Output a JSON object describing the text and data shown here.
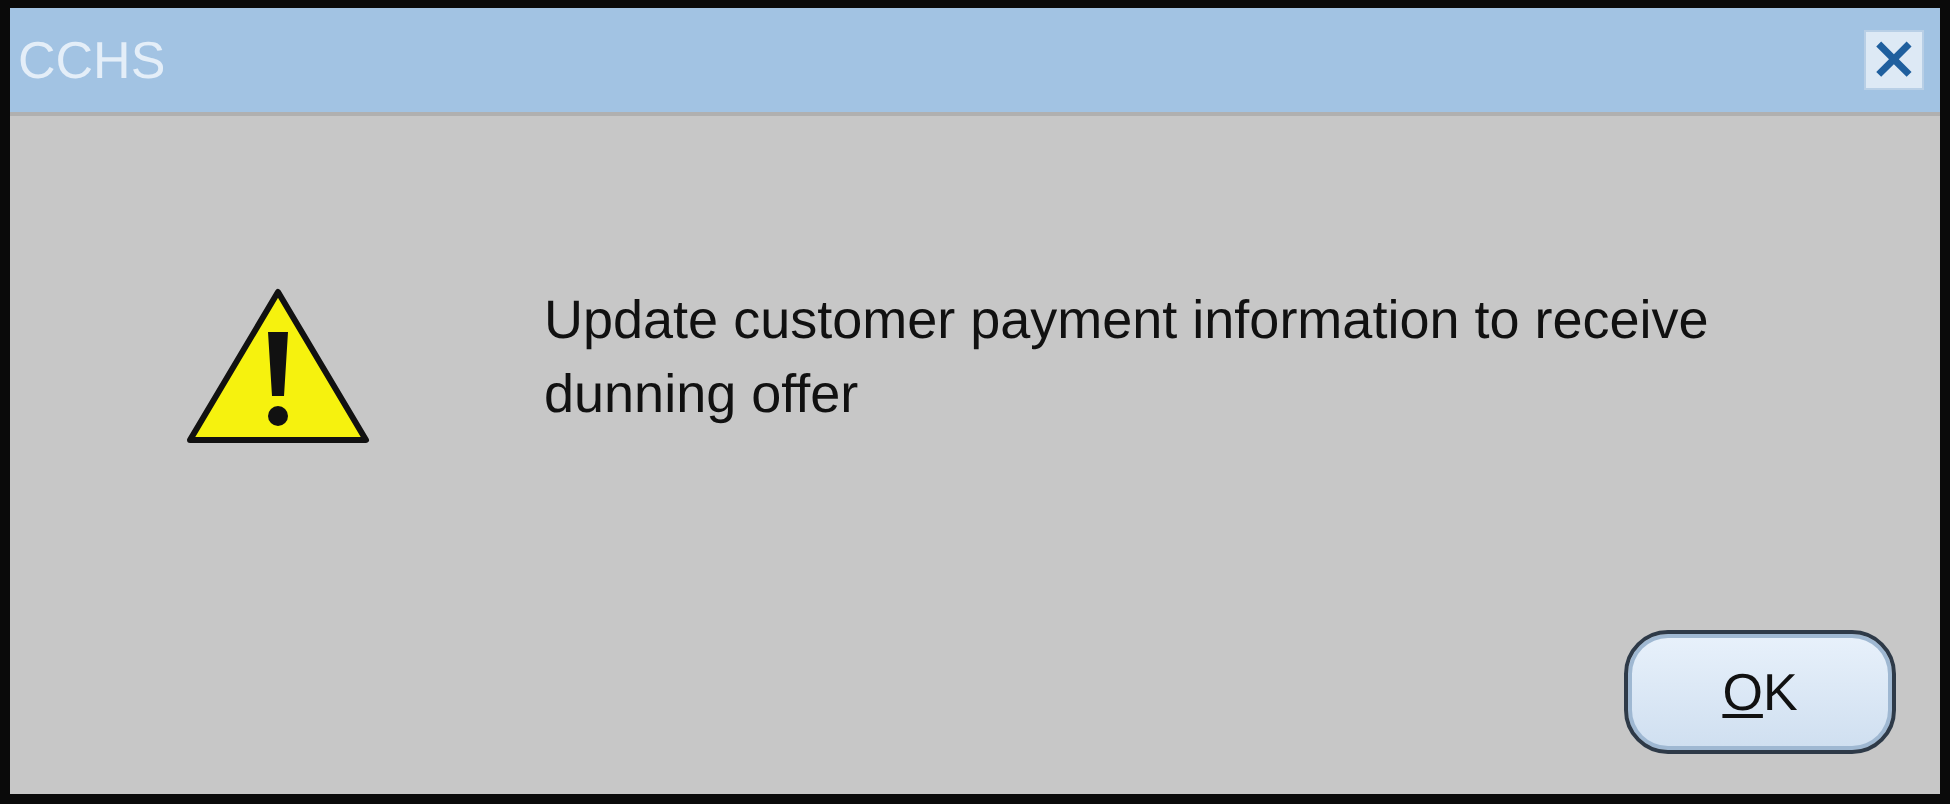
{
  "window": {
    "title": "CCHS",
    "close_label": "×"
  },
  "message": "Update customer payment information to receive dunning offer",
  "buttons": [
    {
      "label": "OK",
      "mnemonic": true
    }
  ]
}
